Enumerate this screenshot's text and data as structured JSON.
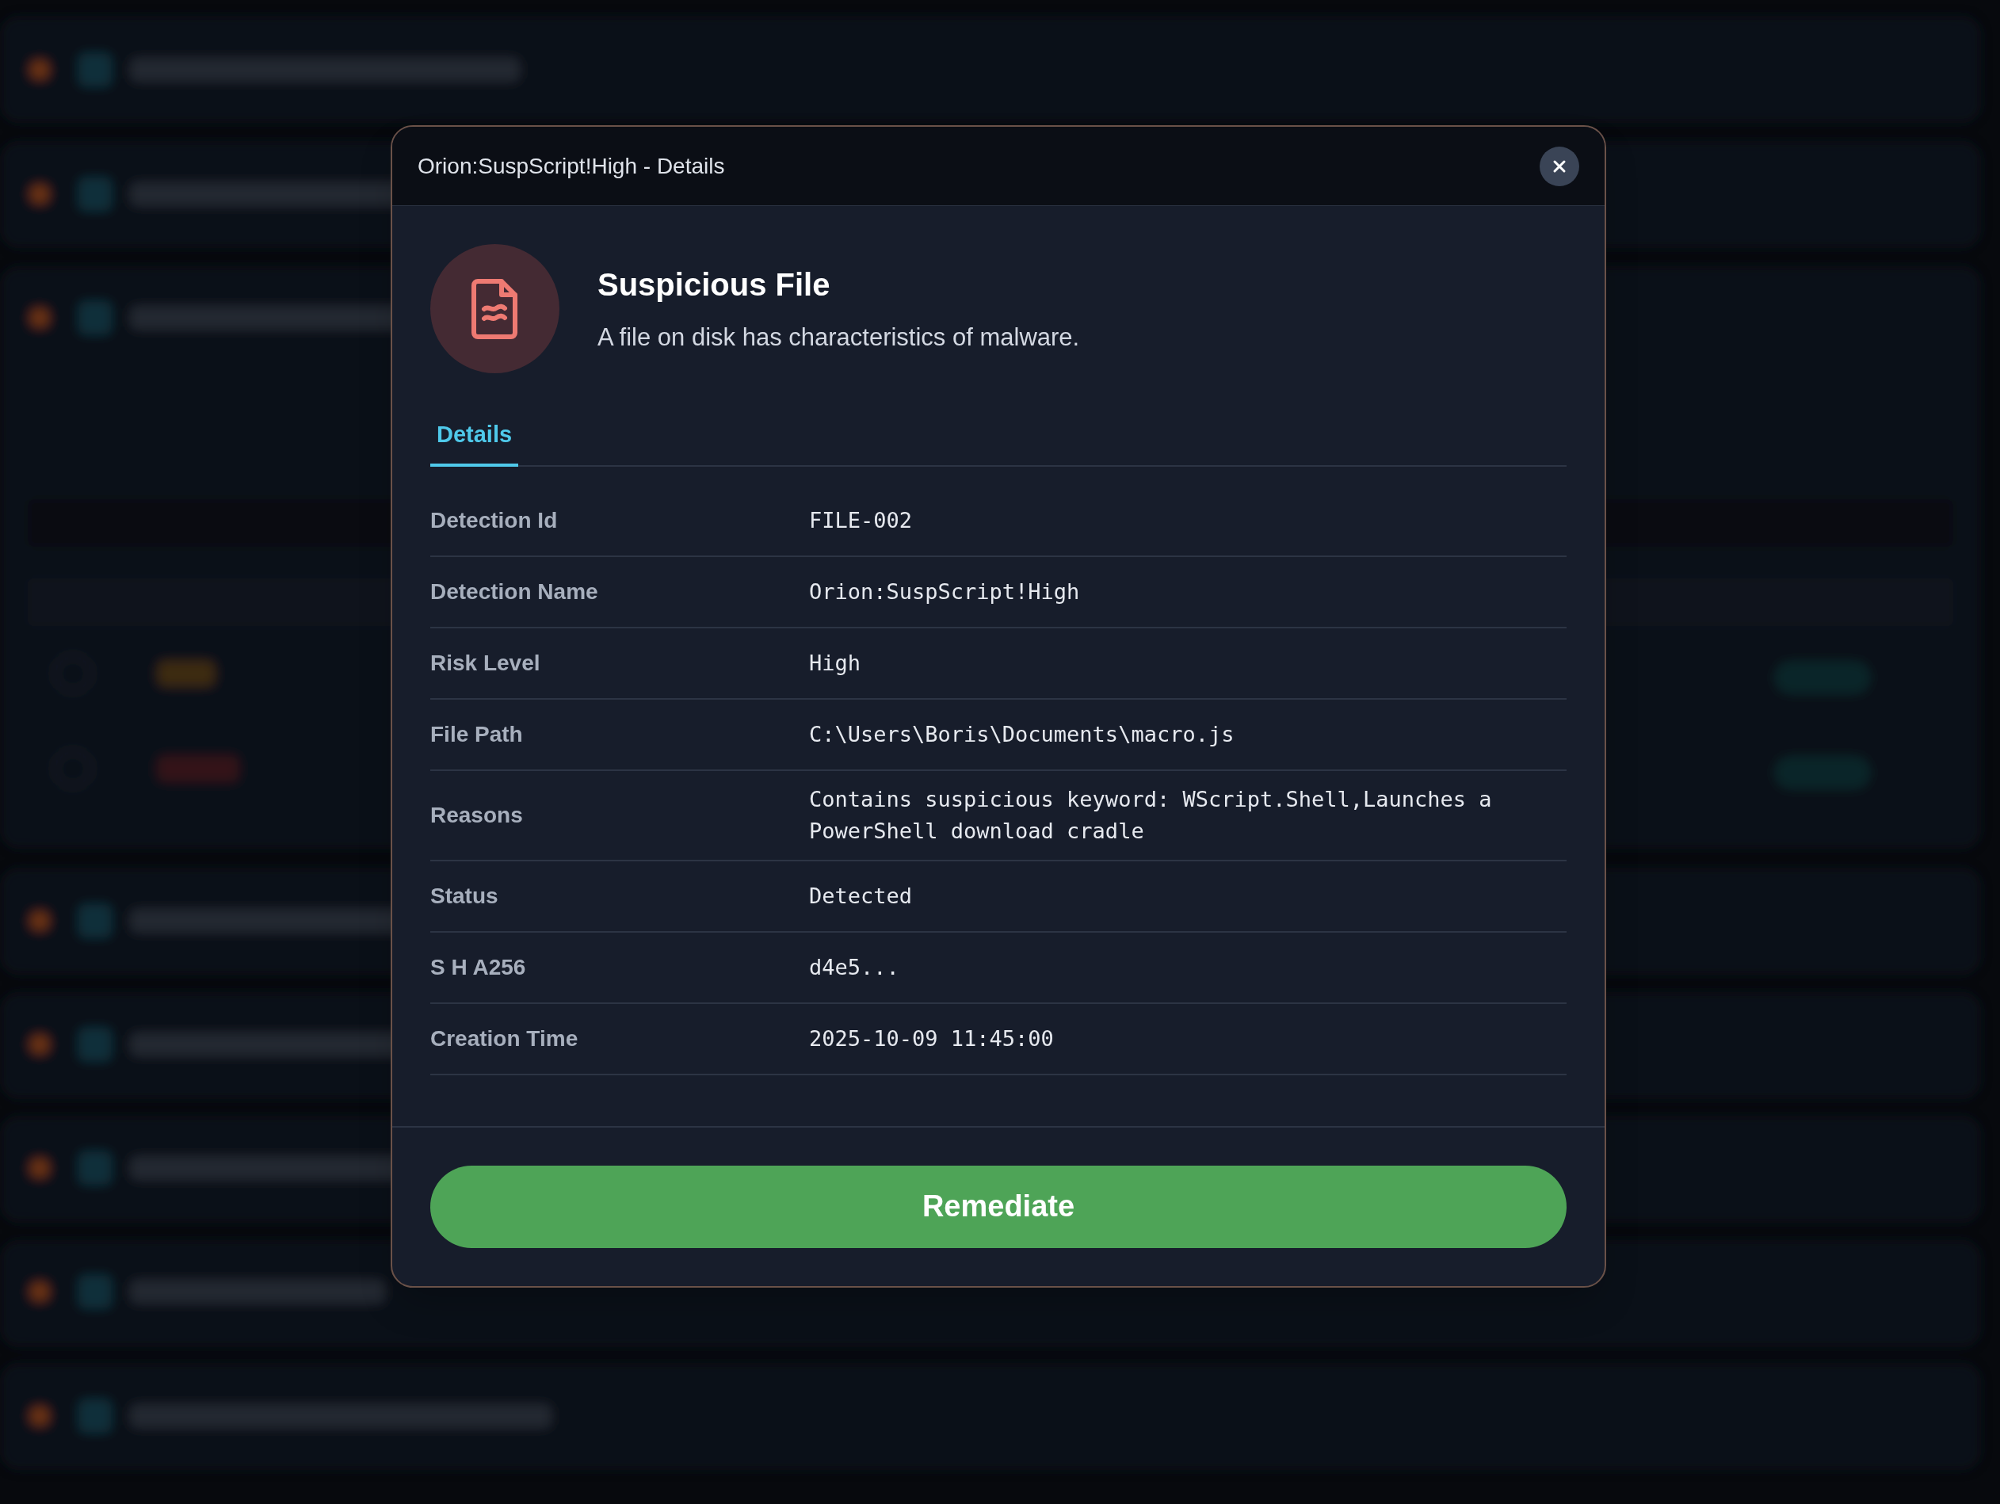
{
  "dialog": {
    "title": "Orion:SuspScript!High - Details",
    "heading": "Suspicious File",
    "description": "A file on disk has characteristics of malware.",
    "tabs": [
      {
        "label": "Details",
        "selected": true
      }
    ],
    "fields": [
      {
        "label": "Detection Id",
        "value": "FILE-002"
      },
      {
        "label": "Detection Name",
        "value": "Orion:SuspScript!High"
      },
      {
        "label": "Risk Level",
        "value": "High"
      },
      {
        "label": "File Path",
        "value": "C:\\Users\\Boris\\Documents\\macro.js"
      },
      {
        "label": "Reasons",
        "value": "Contains suspicious keyword: WScript.Shell,Launches a PowerShell download cradle"
      },
      {
        "label": "Status",
        "value": "Detected"
      },
      {
        "label": "S H A256",
        "value": "d4e5..."
      },
      {
        "label": "Creation Time",
        "value": "2025-10-09 11:45:00"
      }
    ],
    "action": "Remediate"
  }
}
